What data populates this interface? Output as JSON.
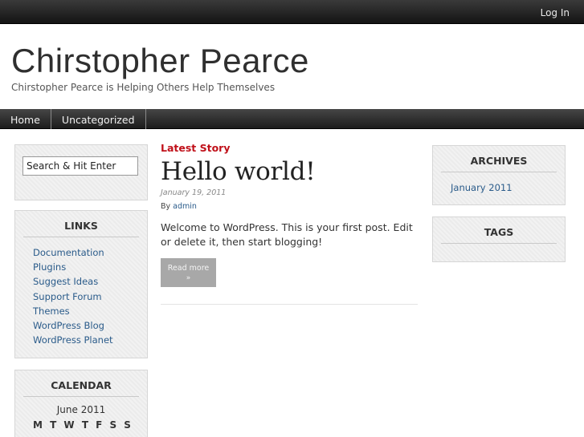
{
  "topbar": {
    "login_label": "Log In"
  },
  "header": {
    "title": "Chirstopher Pearce",
    "description": "Chirstopher Pearce is Helping Others Help Themselves"
  },
  "nav": {
    "items": [
      "Home",
      "Uncategorized"
    ]
  },
  "sidebar_left": {
    "search_placeholder": "Search & Hit Enter",
    "links_title": "LINKS",
    "links": [
      "Documentation",
      "Plugins",
      "Suggest Ideas",
      "Support Forum",
      "Themes",
      "WordPress Blog",
      "WordPress Planet"
    ],
    "calendar_title": "CALENDAR",
    "calendar_month": "June 2011",
    "calendar_days": [
      "M",
      "T",
      "W",
      "T",
      "F",
      "S",
      "S"
    ]
  },
  "main": {
    "latest_label": "Latest Story",
    "post": {
      "title": "Hello world!",
      "date": "January 19, 2011",
      "by_label": "By",
      "author": "admin",
      "excerpt": "Welcome to WordPress. This is your first post. Edit or delete it, then start blogging!",
      "read_more": "Read more",
      "read_more_arrow": "»"
    }
  },
  "sidebar_right": {
    "archives_title": "ARCHIVES",
    "archives": [
      "January 2011"
    ],
    "tags_title": "TAGS"
  },
  "colors": {
    "accent_red": "#c0111a",
    "link_blue": "#2a5b8a",
    "bar_dark": "#1c1c1c"
  }
}
